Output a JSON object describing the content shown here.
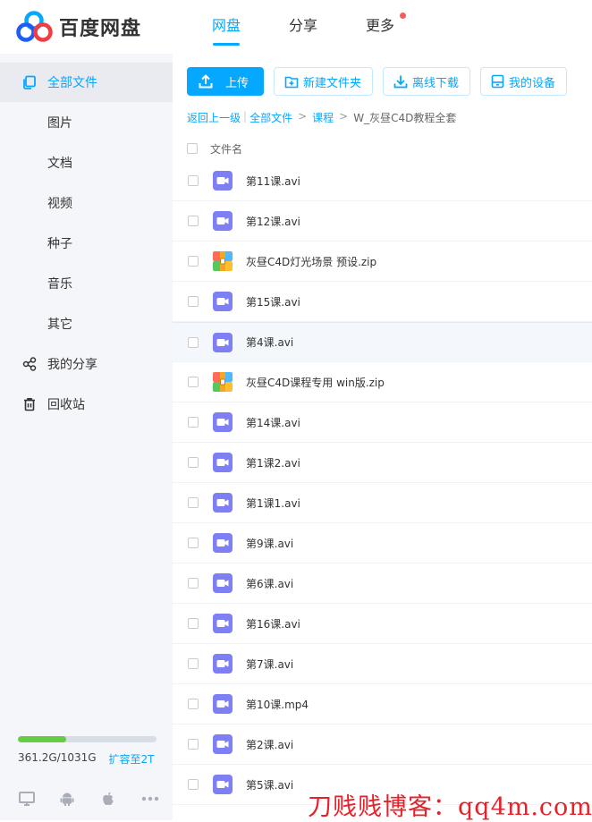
{
  "app": {
    "name": "百度网盘",
    "brand_color": "#06a7ff"
  },
  "nav": {
    "items": [
      {
        "label": "网盘",
        "active": true
      },
      {
        "label": "分享",
        "active": false
      },
      {
        "label": "更多",
        "active": false,
        "badge": true
      }
    ]
  },
  "sidebar": {
    "items": [
      {
        "label": "全部文件",
        "icon": "folder-copy-icon",
        "active": true
      },
      {
        "label": "图片"
      },
      {
        "label": "文档"
      },
      {
        "label": "视频"
      },
      {
        "label": "种子"
      },
      {
        "label": "音乐"
      },
      {
        "label": "其它"
      },
      {
        "label": "我的分享",
        "icon": "share-icon"
      },
      {
        "label": "回收站",
        "icon": "trash-icon"
      }
    ],
    "quota": {
      "used_text": "361.2G/1031G",
      "used_fraction": 0.35,
      "upgrade_label": "扩容至2T"
    },
    "platforms": [
      "desktop-icon",
      "android-icon",
      "apple-icon",
      "more-icon"
    ]
  },
  "toolbar": {
    "upload_label": "上传",
    "new_folder_label": "新建文件夹",
    "offline_download_label": "离线下载",
    "my_device_label": "我的设备"
  },
  "breadcrumb": {
    "back_label": "返回上一级",
    "root_label": "全部文件",
    "parent_label": "课程",
    "current_label": "W_灰昼C4D教程全套"
  },
  "list": {
    "header_label": "文件名",
    "files": [
      {
        "name": "第11课.avi",
        "type": "video"
      },
      {
        "name": "第12课.avi",
        "type": "video"
      },
      {
        "name": "灰昼C4D灯光场景 预设.zip",
        "type": "zip"
      },
      {
        "name": "第15课.avi",
        "type": "video"
      },
      {
        "name": "第4课.avi",
        "type": "video"
      },
      {
        "name": "灰昼C4D课程专用 win版.zip",
        "type": "zip"
      },
      {
        "name": "第14课.avi",
        "type": "video"
      },
      {
        "name": "第1课2.avi",
        "type": "video"
      },
      {
        "name": "第1课1.avi",
        "type": "video"
      },
      {
        "name": "第9课.avi",
        "type": "video"
      },
      {
        "name": "第6课.avi",
        "type": "video"
      },
      {
        "name": "第16课.avi",
        "type": "video"
      },
      {
        "name": "第7课.avi",
        "type": "video"
      },
      {
        "name": "第10课.mp4",
        "type": "video"
      },
      {
        "name": "第2课.avi",
        "type": "video"
      },
      {
        "name": "第5课.avi",
        "type": "video"
      }
    ]
  },
  "watermark": "刀贱贱博客：qq4m.com"
}
